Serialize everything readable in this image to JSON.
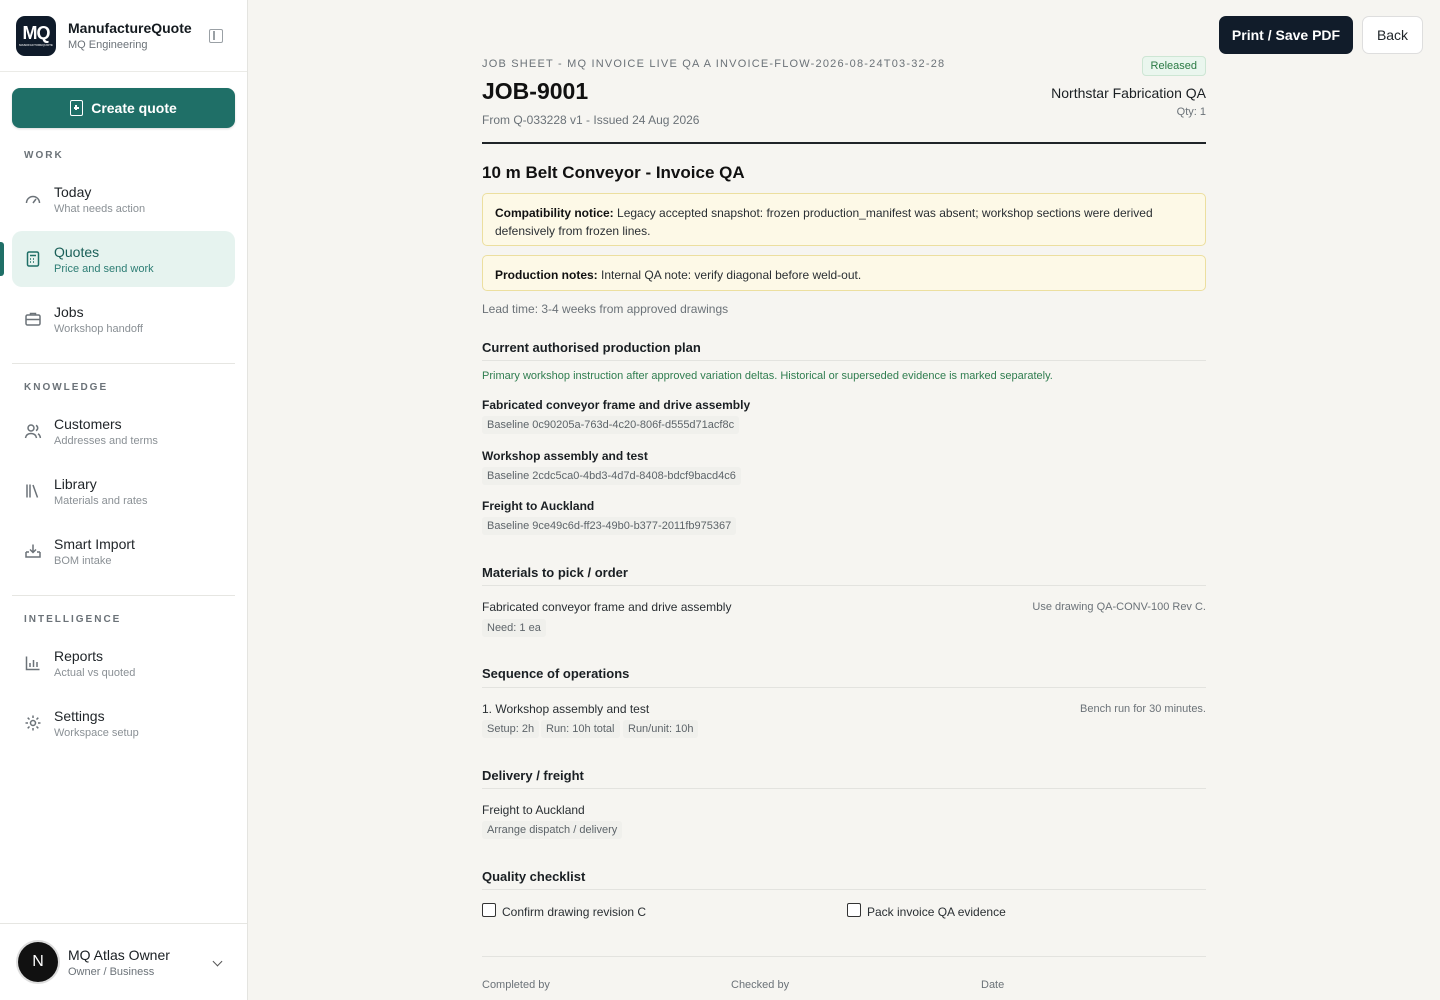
{
  "sidebar": {
    "brand_name": "ManufactureQuote",
    "brand_sub": "MQ Engineering",
    "logo_text": "MQ",
    "create_label": "Create quote",
    "sections": {
      "work": "WORK",
      "knowledge": "KNOWLEDGE",
      "intelligence": "INTELLIGENCE"
    },
    "items": [
      {
        "title": "Today",
        "sub": "What needs action",
        "icon": "gauge-icon"
      },
      {
        "title": "Quotes",
        "sub": "Price and send work",
        "icon": "calculator-icon",
        "active": true
      },
      {
        "title": "Jobs",
        "sub": "Workshop handoff",
        "icon": "briefcase-icon"
      },
      {
        "title": "Customers",
        "sub": "Addresses and terms",
        "icon": "users-icon"
      },
      {
        "title": "Library",
        "sub": "Materials and rates",
        "icon": "library-icon"
      },
      {
        "title": "Smart Import",
        "sub": "BOM intake",
        "icon": "import-icon"
      },
      {
        "title": "Reports",
        "sub": "Actual vs quoted",
        "icon": "bar-chart-icon"
      },
      {
        "title": "Settings",
        "sub": "Workspace setup",
        "icon": "gear-icon"
      }
    ],
    "user": {
      "initial": "N",
      "name": "MQ Atlas Owner",
      "role": "Owner / Business"
    }
  },
  "toolbar": {
    "print_label": "Print / Save PDF",
    "back_label": "Back"
  },
  "doc": {
    "eyebrow": "JOB SHEET - MQ INVOICE LIVE QA A INVOICE-FLOW-2026-08-24T03-32-28",
    "status": "Released",
    "job_number": "JOB-9001",
    "customer": "Northstar Fabrication QA",
    "issued": "From Q-033228 v1 - Issued 24 Aug 2026",
    "qty": "Qty: 1",
    "product_title": "10 m Belt Conveyor - Invoice QA",
    "compat_label": "Compatibility notice:",
    "compat_text": "Legacy accepted snapshot: frozen production_manifest was absent; workshop sections were derived defensively from frozen lines.",
    "prod_label": "Production notes:",
    "prod_text": "Internal QA note: verify diagonal before weld-out.",
    "lead_time": "Lead time: 3-4 weeks from approved drawings",
    "plan": {
      "title": "Current authorised production plan",
      "note": "Primary workshop instruction after approved variation deltas. Historical or superseded evidence is marked separately.",
      "items": [
        {
          "title": "Fabricated conveyor frame and drive assembly",
          "baseline": "Baseline 0c90205a-763d-4c20-806f-d555d71acf8c"
        },
        {
          "title": "Workshop assembly and test",
          "baseline": "Baseline 2cdc5ca0-4bd3-4d7d-8408-bdcf9bacd4c6"
        },
        {
          "title": "Freight to Auckland",
          "baseline": "Baseline 9ce49c6d-ff23-49b0-b377-2011fb975367"
        }
      ]
    },
    "materials": {
      "title": "Materials to pick / order",
      "item": "Fabricated conveyor frame and drive assembly",
      "note": "Use drawing QA-CONV-100 Rev C.",
      "need": "Need: 1 ea"
    },
    "operations": {
      "title": "Sequence of operations",
      "item": "1. Workshop assembly and test",
      "note": "Bench run for 30 minutes.",
      "setup": "Setup: 2h",
      "run": "Run: 10h total",
      "run_unit": "Run/unit: 10h"
    },
    "delivery": {
      "title": "Delivery / freight",
      "item": "Freight to Auckland",
      "chip": "Arrange dispatch / delivery"
    },
    "quality": {
      "title": "Quality checklist",
      "checks": [
        "Confirm drawing revision C",
        "Pack invoice QA evidence"
      ]
    },
    "signoff": {
      "completed": "Completed by",
      "checked": "Checked by",
      "date": "Date"
    }
  }
}
